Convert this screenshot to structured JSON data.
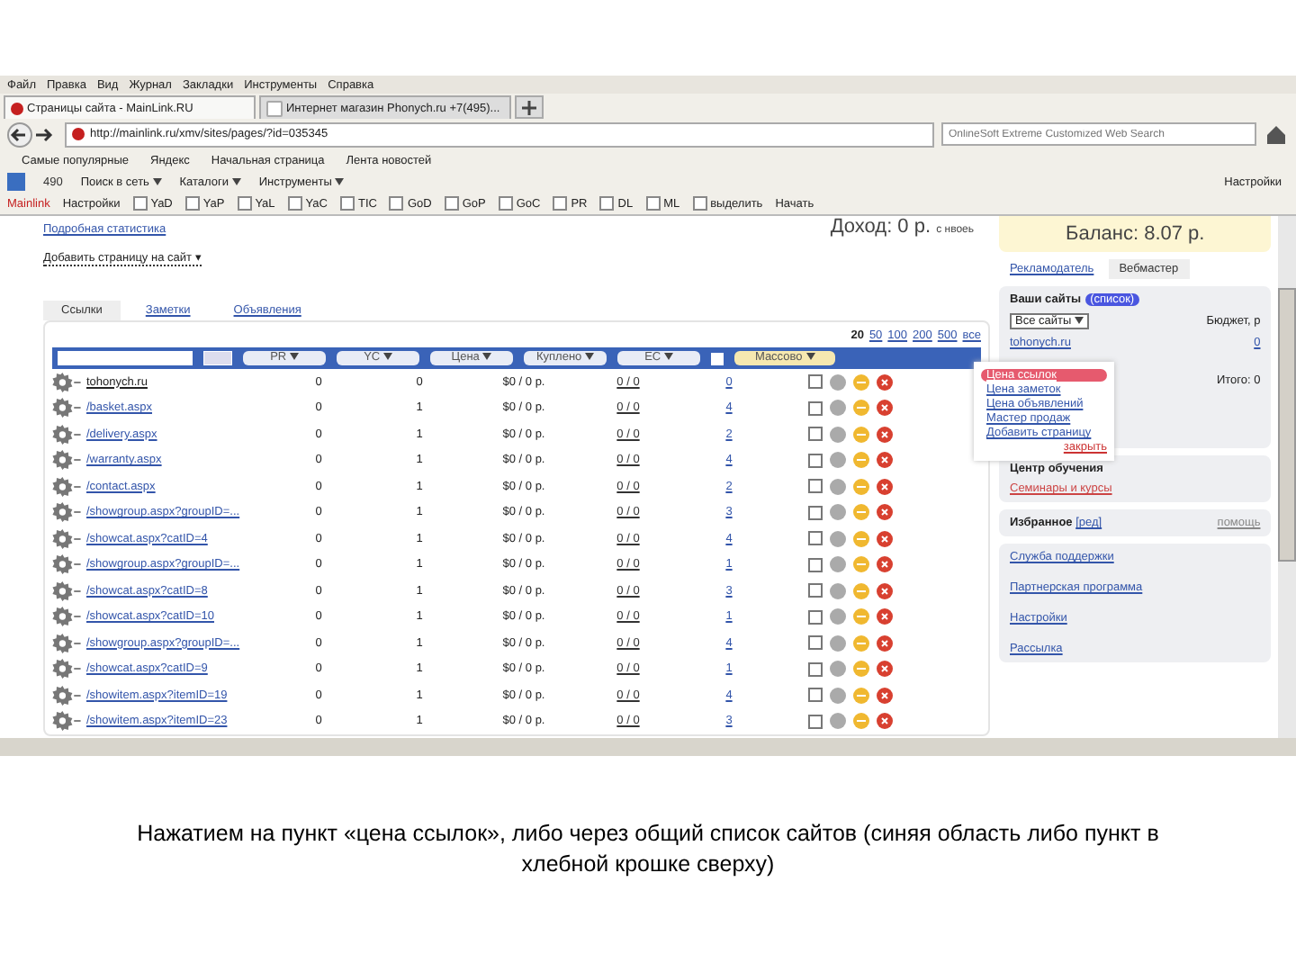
{
  "browser": {
    "menu": [
      "Файл",
      "Правка",
      "Вид",
      "Журнал",
      "Закладки",
      "Инструменты",
      "Справка"
    ],
    "tabs": [
      {
        "label": "Страницы сайта - MainLink.RU",
        "selected": true
      },
      {
        "label": "Интернет магазин Phonych.ru +7(495)...",
        "selected": false
      }
    ],
    "url": "http://mainlink.ru/xmv/sites/pages/?id=035345",
    "search_placeholder": "OnlineSoft Extreme Customized Web Search",
    "bookmarks": [
      "Самые популярные",
      "Яндекс",
      "Начальная страница",
      "Лента новостей"
    ],
    "toolbar": {
      "counter": "490",
      "items": [
        "Поиск в сеть",
        "Каталоги",
        "Инструменты"
      ],
      "settings": "Настройки"
    },
    "mainlink_bar": {
      "brand": "Mainlink",
      "settings": "Настройки",
      "checks": [
        {
          "label": "YaD",
          "checked": false
        },
        {
          "label": "YaP",
          "checked": false
        },
        {
          "label": "YaL",
          "checked": false
        },
        {
          "label": "YaC",
          "checked": false
        },
        {
          "label": "TIC",
          "checked": false
        },
        {
          "label": "GoD",
          "checked": false
        },
        {
          "label": "GoP",
          "checked": false
        },
        {
          "label": "GoC",
          "checked": false
        },
        {
          "label": "PR",
          "checked": false
        },
        {
          "label": "DL",
          "checked": false
        },
        {
          "label": "ML",
          "checked": false
        },
        {
          "label": "выделить",
          "checked": false
        }
      ],
      "action": "Начать"
    }
  },
  "page": {
    "links": [
      "Подробная статистика",
      "Добавить страницу на сайт ▾"
    ],
    "income": "Доход: 0 р.",
    "income_note": "с нвоеь",
    "balance": "Баланс: 8.07 р.",
    "content_tabs": [
      {
        "label": "Ссылки",
        "selected": true
      },
      {
        "label": "Заметки",
        "selected": false
      },
      {
        "label": "Объявления",
        "selected": false
      }
    ],
    "page_sizes": [
      {
        "label": "20",
        "selected": true
      },
      {
        "label": "50",
        "selected": false
      },
      {
        "label": "100",
        "selected": false
      },
      {
        "label": "200",
        "selected": false
      },
      {
        "label": "500",
        "selected": false
      },
      {
        "label": "все",
        "selected": false
      }
    ],
    "columns": [
      "PR",
      "YC",
      "Цена",
      "Куплено",
      "ЕС",
      "Массово"
    ],
    "select_all_checked": false,
    "rows": [
      {
        "path": "tohonych.ru",
        "root": true,
        "pr": "0",
        "yc": "0",
        "price": "$0 / 0 р.",
        "bought": "0 / 0",
        "ec": "0",
        "checked": false
      },
      {
        "path": "/basket.aspx",
        "root": false,
        "pr": "0",
        "yc": "1",
        "price": "$0 / 0 р.",
        "bought": "0 / 0",
        "ec": "4",
        "checked": false
      },
      {
        "path": "/delivery.aspx",
        "root": false,
        "pr": "0",
        "yc": "1",
        "price": "$0 / 0 р.",
        "bought": "0 / 0",
        "ec": "2",
        "checked": false
      },
      {
        "path": "/warranty.aspx",
        "root": false,
        "pr": "0",
        "yc": "1",
        "price": "$0 / 0 р.",
        "bought": "0 / 0",
        "ec": "4",
        "checked": false
      },
      {
        "path": "/contact.aspx",
        "root": false,
        "pr": "0",
        "yc": "1",
        "price": "$0 / 0 р.",
        "bought": "0 / 0",
        "ec": "2",
        "checked": false
      },
      {
        "path": "/showgroup.aspx?groupID=...",
        "root": false,
        "pr": "0",
        "yc": "1",
        "price": "$0 / 0 р.",
        "bought": "0 / 0",
        "ec": "3",
        "checked": false
      },
      {
        "path": "/showcat.aspx?catID=4",
        "root": false,
        "pr": "0",
        "yc": "1",
        "price": "$0 / 0 р.",
        "bought": "0 / 0",
        "ec": "4",
        "checked": false
      },
      {
        "path": "/showgroup.aspx?groupID=...",
        "root": false,
        "pr": "0",
        "yc": "1",
        "price": "$0 / 0 р.",
        "bought": "0 / 0",
        "ec": "1",
        "checked": false
      },
      {
        "path": "/showcat.aspx?catID=8",
        "root": false,
        "pr": "0",
        "yc": "1",
        "price": "$0 / 0 р.",
        "bought": "0 / 0",
        "ec": "3",
        "checked": false
      },
      {
        "path": "/showcat.aspx?catID=10",
        "root": false,
        "pr": "0",
        "yc": "1",
        "price": "$0 / 0 р.",
        "bought": "0 / 0",
        "ec": "1",
        "checked": false
      },
      {
        "path": "/showgroup.aspx?groupID=...",
        "root": false,
        "pr": "0",
        "yc": "1",
        "price": "$0 / 0 р.",
        "bought": "0 / 0",
        "ec": "4",
        "checked": false
      },
      {
        "path": "/showcat.aspx?catID=9",
        "root": false,
        "pr": "0",
        "yc": "1",
        "price": "$0 / 0 р.",
        "bought": "0 / 0",
        "ec": "1",
        "checked": false
      },
      {
        "path": "/showitem.aspx?itemID=19",
        "root": false,
        "pr": "0",
        "yc": "1",
        "price": "$0 / 0 р.",
        "bought": "0 / 0",
        "ec": "4",
        "checked": false
      },
      {
        "path": "/showitem.aspx?itemID=23",
        "root": false,
        "pr": "0",
        "yc": "1",
        "price": "$0 / 0 р.",
        "bought": "0 / 0",
        "ec": "3",
        "checked": false
      }
    ]
  },
  "sidebar": {
    "tabs": [
      {
        "label": "Рекламодатель",
        "selected": false
      },
      {
        "label": "Вебмастер",
        "selected": true
      }
    ],
    "sites_title": "Ваши сайты",
    "sites_badge": "(список)",
    "site_filter": "Все сайты",
    "budget_label": "Бюджет, р",
    "site": "tohonych.ru",
    "site_value": "0",
    "total": "Итого: 0",
    "menu": [
      {
        "label": "Цена ссылок",
        "selected": true
      },
      {
        "label": "Цена заметок",
        "selected": false
      },
      {
        "label": "Цена объявлений",
        "selected": false
      },
      {
        "label": "Мастер продаж",
        "selected": false
      },
      {
        "label": "Добавить страницу",
        "selected": false
      }
    ],
    "menu_close": "закрыть",
    "learning_title": "Центр обучения",
    "learning_link": "Семинары и курсы",
    "favorites": "Избранное",
    "favorites_edit": "[ред]",
    "help": "помощь",
    "links": [
      "Служба поддержки",
      "Партнерская программа",
      "Настройки",
      "Рассылка"
    ]
  },
  "caption": "Нажатием на пункт «цена ссылок», либо через общий список сайтов (синяя область либо пункт в хлебной крошке сверху)"
}
